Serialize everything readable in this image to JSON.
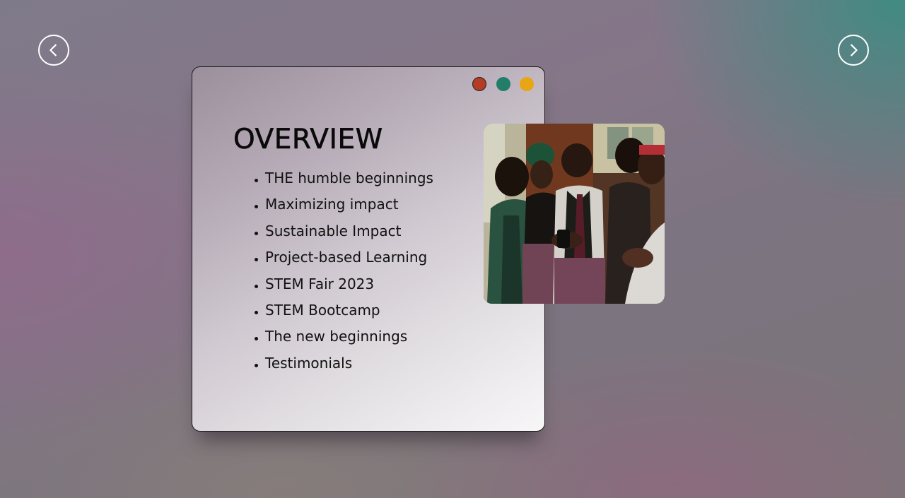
{
  "nav": {
    "prev_icon": "chevron-left-icon",
    "next_icon": "chevron-right-icon"
  },
  "window_controls": {
    "colors": [
      "#b33c24",
      "#237d6a",
      "#e8a614"
    ]
  },
  "overview": {
    "title": "OVERVIEW",
    "items": [
      "THE humble beginnings",
      "Maximizing impact",
      "Sustainable Impact",
      "Project-based Learning",
      "STEM Fair 2023",
      "STEM Bootcamp",
      "The new beginnings",
      "Testimonials"
    ]
  },
  "photo": {
    "subject": "students-group-photo"
  }
}
